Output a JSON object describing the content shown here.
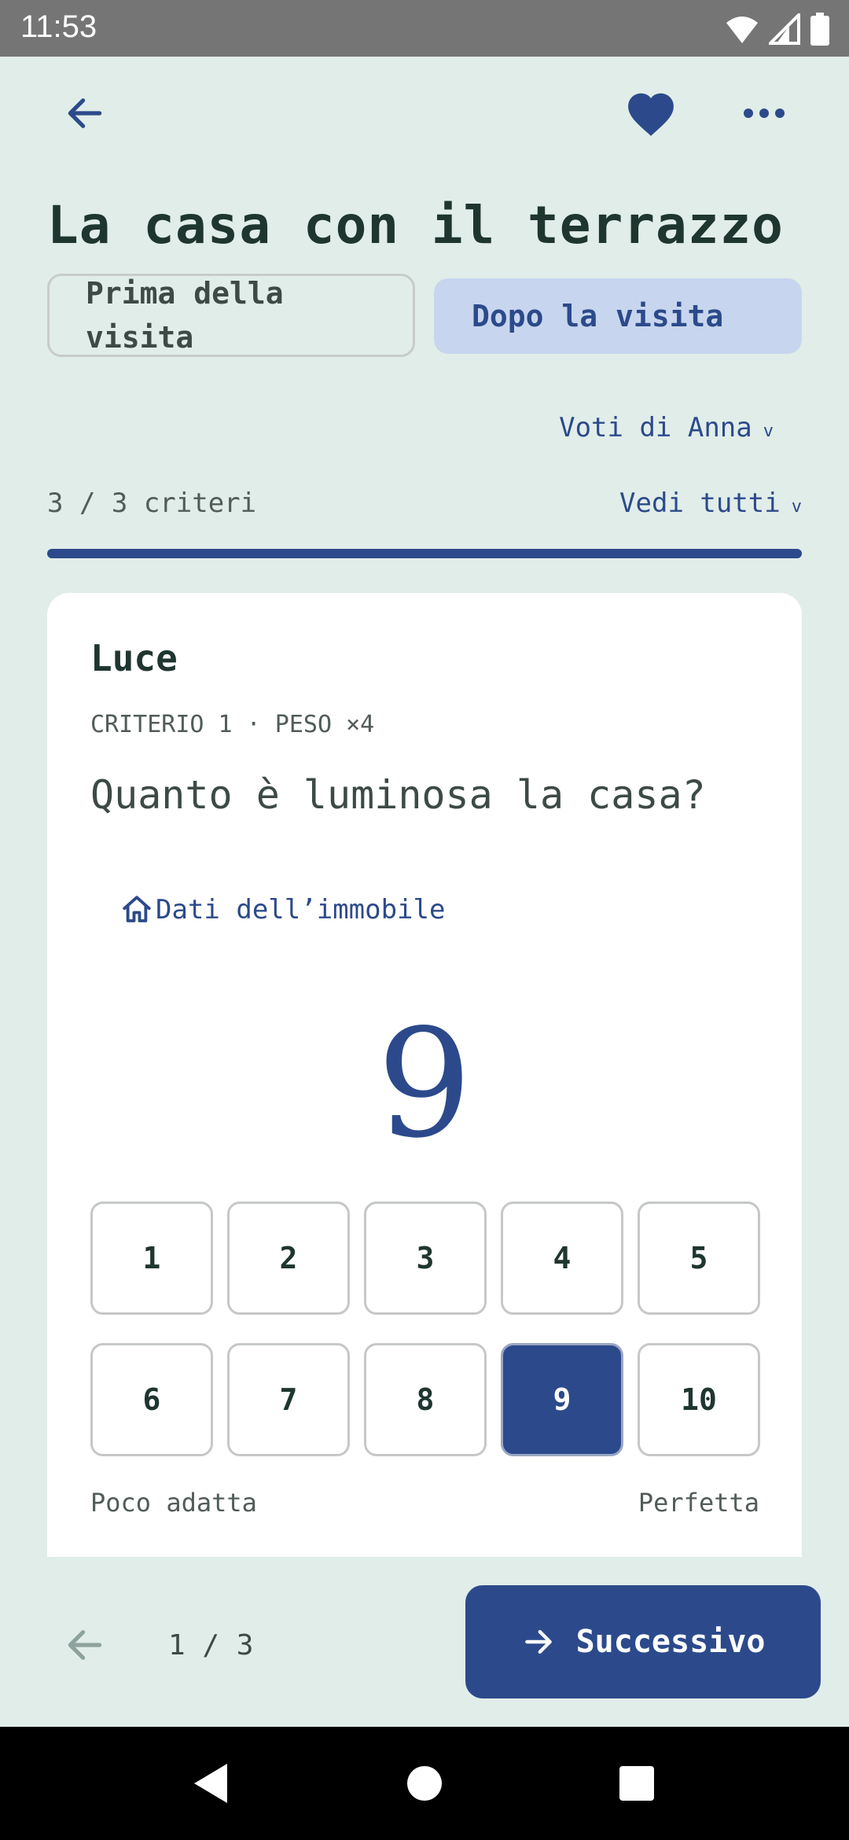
{
  "status_bar": {
    "time": "11:53"
  },
  "header": {
    "title": "La casa con il terrazzo",
    "back_icon": "arrow-left-icon",
    "favorite_icon": "heart-icon",
    "more_icon": "more-horizontal-icon"
  },
  "phase_tabs": {
    "before_label": "Prima della\nvisita",
    "after_label": "Dopo la visita",
    "selected": "after"
  },
  "ratings_owner": {
    "label": "Voti di Anna",
    "chevron": "v"
  },
  "criteria_progress": {
    "count_label": "3 / 3 criteri",
    "see_all_label": "Vedi tutti",
    "chevron": "v",
    "fraction": 1.0
  },
  "criterion": {
    "name": "Luce",
    "meta": "CRITERIO 1 · PESO ×4",
    "question": "Quanto è luminosa la casa?",
    "property_link": "Dati dell’immobile",
    "score_display": "9",
    "options": [
      "1",
      "2",
      "3",
      "4",
      "5",
      "6",
      "7",
      "8",
      "9",
      "10"
    ],
    "selected": "9",
    "low_label": "Poco adatta",
    "high_label": "Perfetta"
  },
  "footer": {
    "pager": "1 / 3",
    "next_label": "Successivo"
  },
  "colors": {
    "background": "#e1ede9",
    "accent": "#2c4a8b",
    "selected_tab_bg": "#c7d6ee"
  }
}
